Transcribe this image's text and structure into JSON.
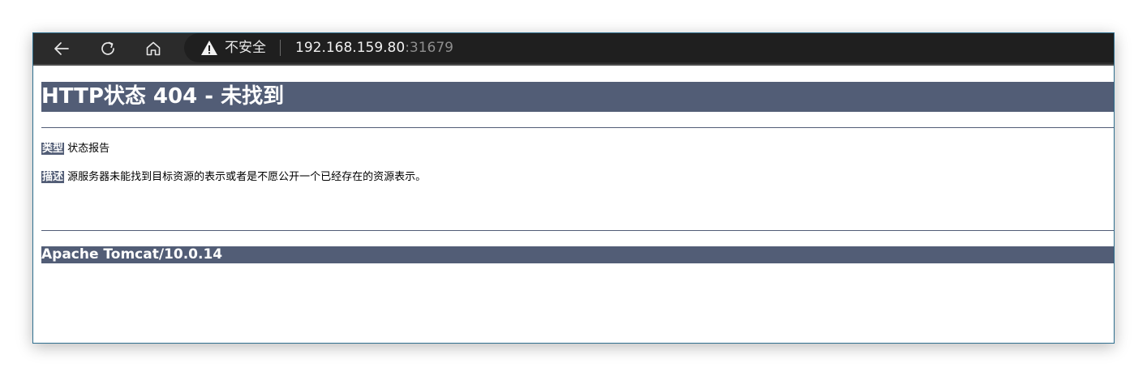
{
  "browser": {
    "security_label": "不安全",
    "url_host": "192.168.159.80",
    "url_port": ":31679",
    "icons": {
      "back": "arrow-left-icon",
      "reload": "reload-icon",
      "home": "home-icon",
      "security": "warning-triangle-icon"
    }
  },
  "page": {
    "heading": "HTTP状态 404 - 未找到",
    "type_label": "类型",
    "type_value": "状态报告",
    "description_label": "描述",
    "description_value": "源服务器未能找到目标资源的表示或者是不愿公开一个已经存在的资源表示。",
    "server_signature": "Apache Tomcat/10.0.14"
  },
  "colors": {
    "accent": "#525d76",
    "toolbar": "#2b2b2b",
    "omnibox": "#1f1f1f"
  }
}
